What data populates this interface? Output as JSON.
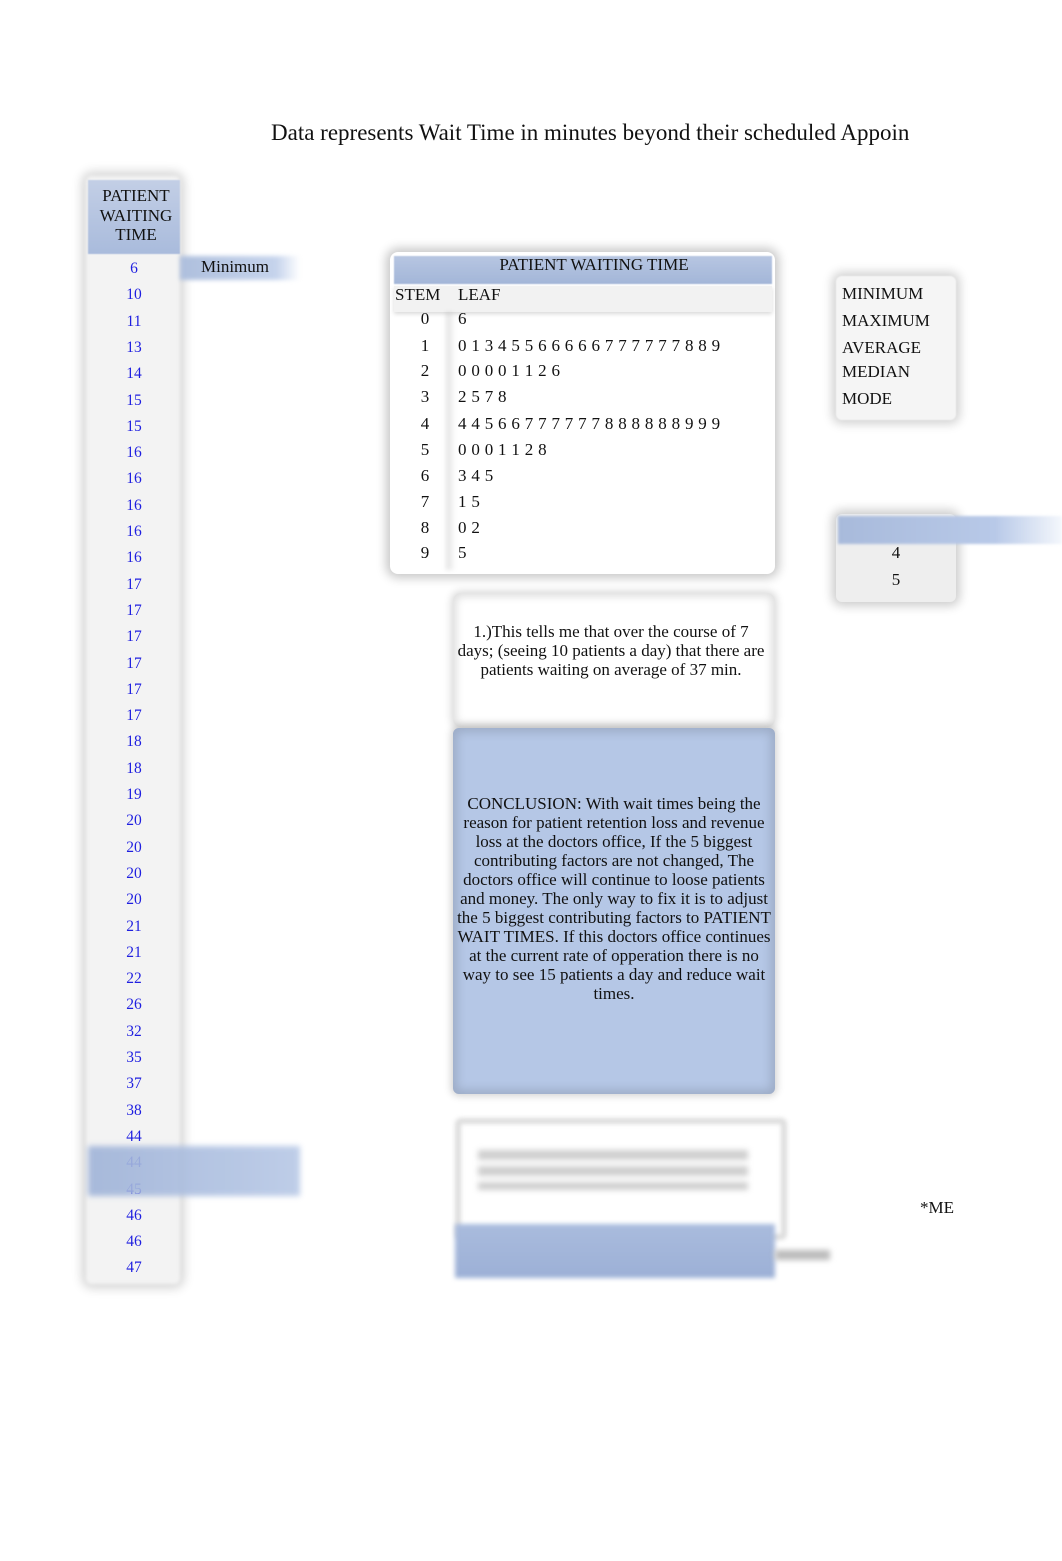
{
  "title": "Data represents Wait Time in minutes beyond their scheduled Appoin",
  "data_column": {
    "header": "PATIENT WAITING TIME",
    "values": [
      6,
      10,
      11,
      13,
      14,
      15,
      15,
      16,
      16,
      16,
      16,
      16,
      17,
      17,
      17,
      17,
      17,
      17,
      18,
      18,
      19,
      20,
      20,
      20,
      20,
      21,
      21,
      22,
      26,
      32,
      35,
      37,
      38,
      44,
      44,
      45,
      46,
      46,
      47
    ]
  },
  "side_label": "Minimum",
  "stem_leaf": {
    "title": "PATIENT WAITING TIME",
    "stem_header": "STEM",
    "leaf_header": "LEAF",
    "rows": [
      {
        "stem": "0",
        "leaf": "6"
      },
      {
        "stem": "1",
        "leaf": "0 1 3 4 5 5 6 6 6 6 6 7 7 7 7 7 7 8 8 9"
      },
      {
        "stem": "2",
        "leaf": "0 0 0 0 1 1 2 6"
      },
      {
        "stem": "3",
        "leaf": "2 5 7 8"
      },
      {
        "stem": "4",
        "leaf": "4 4 5 6 6 7 7 7 7 7 7 8 8 8 8 8 8 9 9 9"
      },
      {
        "stem": "5",
        "leaf": "0 0 0 1 1 2 8"
      },
      {
        "stem": "6",
        "leaf": "3 4 5"
      },
      {
        "stem": "7",
        "leaf": "1 5"
      },
      {
        "stem": "8",
        "leaf": "0 2"
      },
      {
        "stem": "9",
        "leaf": "5"
      }
    ]
  },
  "stats": {
    "labels": [
      "MINIMUM",
      "MAXIMUM",
      "AVERAGE",
      "MEDIAN",
      "MODE"
    ]
  },
  "mode_values": [
    "4",
    "5"
  ],
  "note": "1.)This tells me that over the course of 7 days; (seeing 10 patients a day) that there are patients waiting on average of 37 min.",
  "conclusion": "CONCLUSION: With wait times being the reason for patient retention loss and revenue loss at the doctors office, If the 5 biggest contributing factors are not changed, The doctors office will continue to loose patients and money. The only way to fix it is to adjust the 5 biggest contributing factors to PATIENT WAIT TIMES. If this doctors office continues at the current rate of opperation there is no way to see 15 patients a day and reduce wait times.",
  "footnote": "*ME",
  "colors": {
    "accent_blue": "#b5c7e6",
    "value_text": "#1f1fe0"
  }
}
